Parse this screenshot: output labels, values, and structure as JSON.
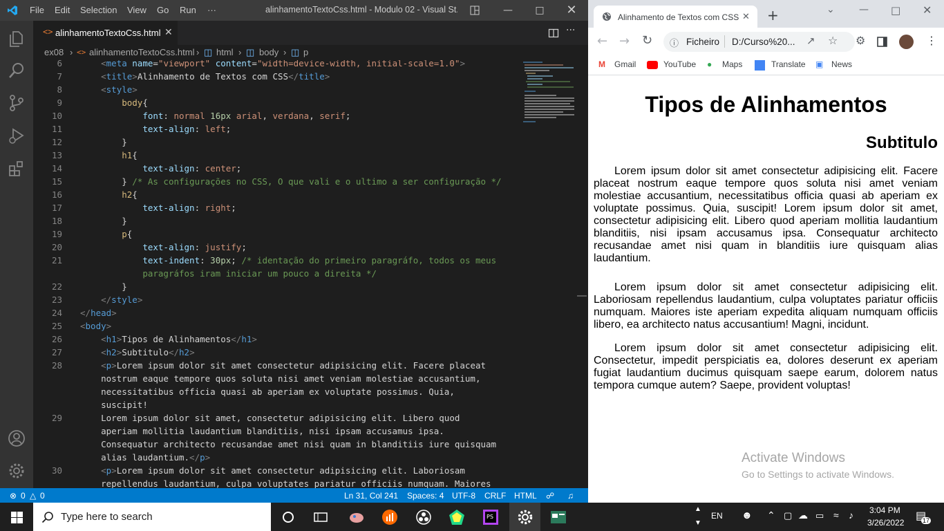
{
  "vscode": {
    "menu": [
      "File",
      "Edit",
      "Selection",
      "View",
      "Go",
      "Run",
      "···"
    ],
    "window_title": "alinhamentoTextoCss.html - Modulo 02 - Visual St...",
    "tab_label": "alinhamentoTextoCss.html",
    "breadcrumb": [
      "ex08",
      "alinhamentoTextoCss.html",
      "html",
      "body",
      "p"
    ],
    "line_numbers": [
      "6",
      "7",
      "8",
      "9",
      "10",
      "11",
      "12",
      "13",
      "14",
      "15",
      "16",
      "17",
      "18",
      "19",
      "20",
      "21",
      "",
      "22",
      "23",
      "24",
      "25",
      "26",
      "27",
      "28",
      "",
      "",
      "",
      "29",
      "",
      "",
      "",
      "30",
      ""
    ],
    "status": {
      "problems": "0",
      "warnings": "0",
      "position": "Ln 31, Col 241",
      "spaces": "Spaces: 4",
      "encoding": "UTF-8",
      "eol": "CRLF",
      "language": "HTML"
    },
    "colors": {
      "statusbar": "#007acc",
      "titlebar": "#3c3c3c",
      "activitybar": "#333333",
      "editor": "#1e1e1e"
    }
  },
  "chrome": {
    "tab_title": "Alinhamento de Textos com CSS",
    "address_label": "Ficheiro",
    "address_url": "D:/Curso%20...",
    "bookmarks": [
      "Gmail",
      "YouTube",
      "Maps",
      "Translate",
      "News"
    ],
    "page": {
      "h1": "Tipos de Alinhamentos",
      "h2": "Subtitulo",
      "p1": "Lorem ipsum dolor sit amet consectetur adipisicing elit. Facere placeat nostrum eaque tempore quos soluta nisi amet veniam molestiae accusantium, necessitatibus officia quasi ab aperiam ex voluptate possimus. Quia, suscipit! Lorem ipsum dolor sit amet, consectetur adipisicing elit. Libero quod aperiam mollitia laudantium blanditiis, nisi ipsam accusamus ipsa. Consequatur architecto recusandae amet nisi quam in blanditiis iure quisquam alias laudantium.",
      "p2": "Lorem ipsum dolor sit amet consectetur adipisicing elit. Laboriosam repellendus laudantium, culpa voluptates pariatur officiis numquam. Maiores iste aperiam expedita aliquam numquam officiis libero, ea architecto natus accusantium! Magni, incidunt.",
      "p3": "Lorem ipsum dolor sit amet consectetur adipisicing elit. Consectetur, impedit perspiciatis ea, dolores deserunt ex aperiam fugiat laudantium ducimus quisquam saepe earum, dolorem natus tempora cumque autem? Saepe, provident voluptas!"
    },
    "watermark_title": "Activate Windows",
    "watermark_sub": "Go to Settings to activate Windows."
  },
  "taskbar": {
    "search_placeholder": "Type here to search",
    "lang": "EN",
    "time": "3:04 PM",
    "date": "3/26/2022",
    "notifications": "17"
  }
}
